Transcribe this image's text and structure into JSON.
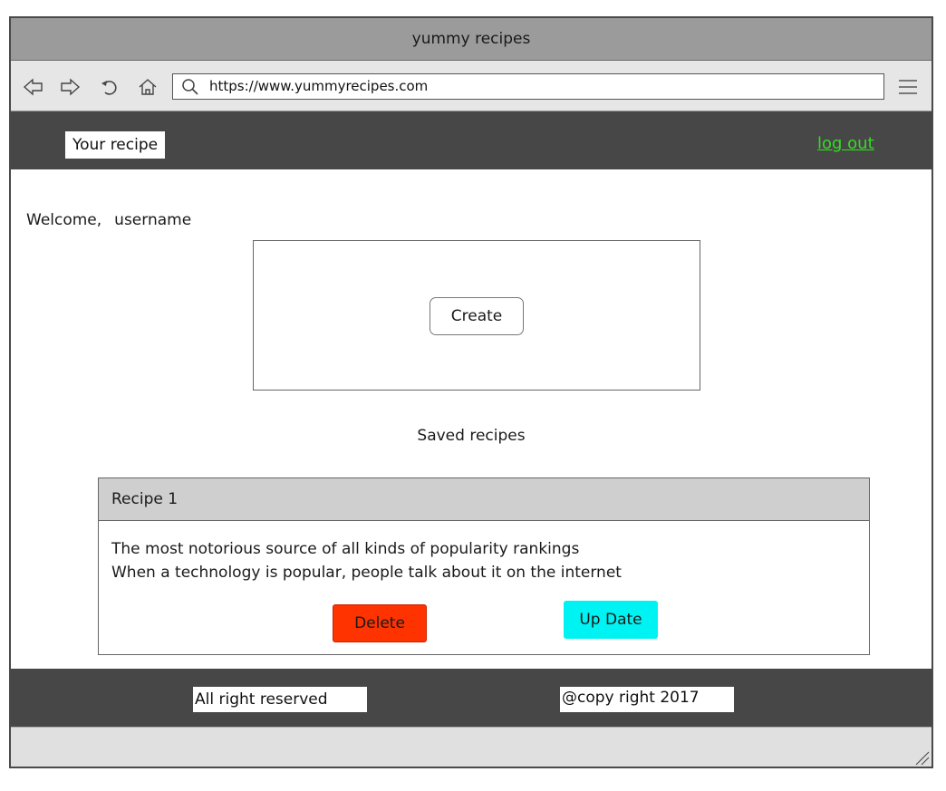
{
  "window": {
    "title": "yummy recipes"
  },
  "browser": {
    "url": "https://www.yummyrecipes.com",
    "icons": [
      "back-icon",
      "forward-icon",
      "reload-icon",
      "home-icon",
      "search-icon",
      "menu-icon"
    ]
  },
  "header": {
    "brand": "Your recipe",
    "logout_label": "log out"
  },
  "main": {
    "welcome_label": "Welcome,",
    "username": "username",
    "create_label": "Create",
    "saved_title": "Saved recipes"
  },
  "recipes": [
    {
      "title": "Recipe 1",
      "lines": [
        "The most notorious source of all kinds of popularity rankings",
        "When a technology is popular, people talk about it on the internet"
      ],
      "delete_label": "Delete",
      "update_label": "Up Date"
    }
  ],
  "footer": {
    "left": "All right reserved",
    "right": "@copy right 2017"
  },
  "colors": {
    "titlebar": "#9b9b9b",
    "header_bg": "#474747",
    "logout_link": "#33dd22",
    "delete_button": "#ff3300",
    "update_button": "#00f3f3"
  }
}
